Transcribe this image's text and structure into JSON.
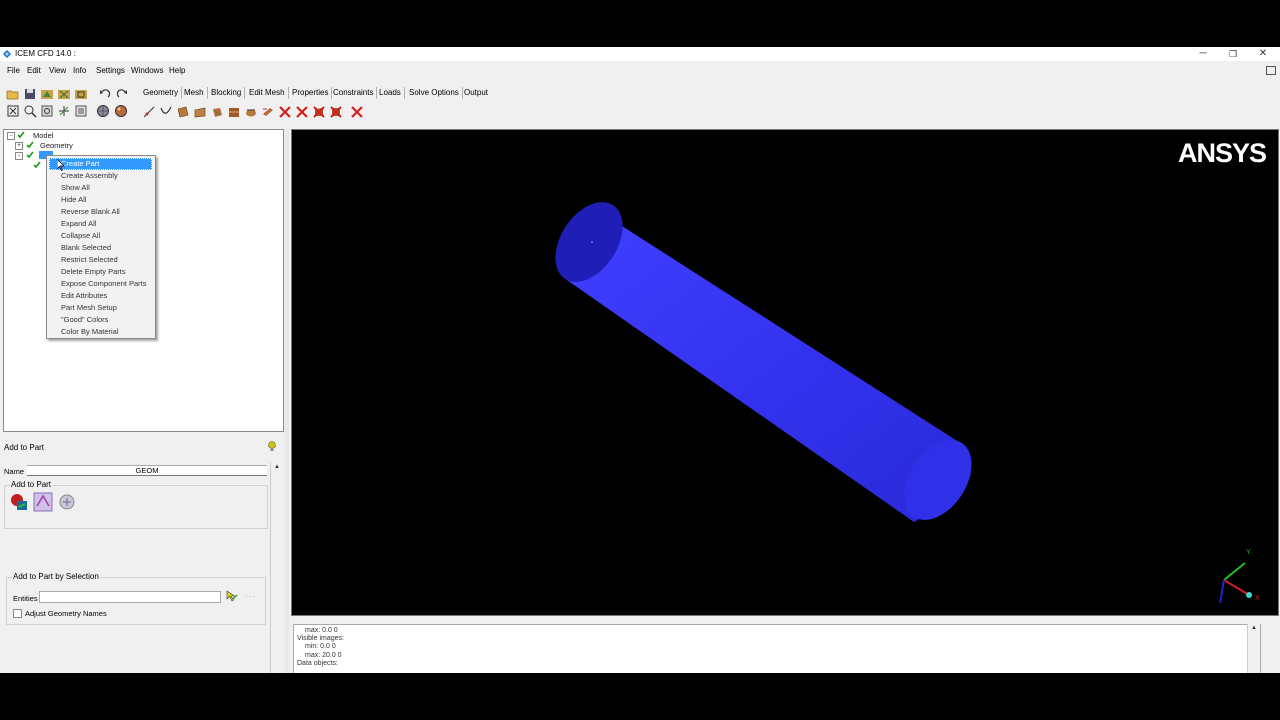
{
  "window": {
    "title": "ICEM CFD 14.0 :",
    "minimize": "─",
    "restore": "❐",
    "close": "✕"
  },
  "menubar": [
    "File",
    "Edit",
    "View",
    "Info",
    "Settings",
    "Windows",
    "Help"
  ],
  "tabs": [
    "Geometry",
    "Mesh",
    "Blocking",
    "Edit Mesh",
    "Properties",
    "Constraints",
    "Loads",
    "Solve Options",
    "Output"
  ],
  "tree": {
    "root": "Model",
    "geometry": "Geometry"
  },
  "context_menu": {
    "items": [
      "Create Part",
      "Create Assembly",
      "Show All",
      "Hide All",
      "Reverse Blank All",
      "Expand All",
      "Collapse All",
      "Blank Selected",
      "Restrict Selected",
      "Delete Empty Parts",
      "Expose Component Parts",
      "Edit Attributes",
      "Part Mesh Setup",
      "\"Good\" Colors",
      "Color By Material"
    ],
    "selected_index": 0
  },
  "viewport": {
    "logo": "ANSYS",
    "background": "#000000",
    "model_color": "#3333ff",
    "triad": {
      "y": "Y",
      "x": "X"
    }
  },
  "add_to_part": {
    "title": "Add to Part",
    "name_label": "Name",
    "name_value": "GEOM",
    "group_label": "Add to Part",
    "selection_group_label": "Add to Part by Selection",
    "entities_label": "Entities",
    "entities_value": "",
    "adjust_label": "Adjust Geometry Names",
    "adjust_checked": false
  },
  "messages": [
    "max: 0.0 0",
    "Visible images:",
    "min: 0.0 0",
    "max: 20.0 0",
    "Data objects:"
  ],
  "colors": {
    "selection": "#3399ff",
    "check": "#1a9a1a"
  }
}
